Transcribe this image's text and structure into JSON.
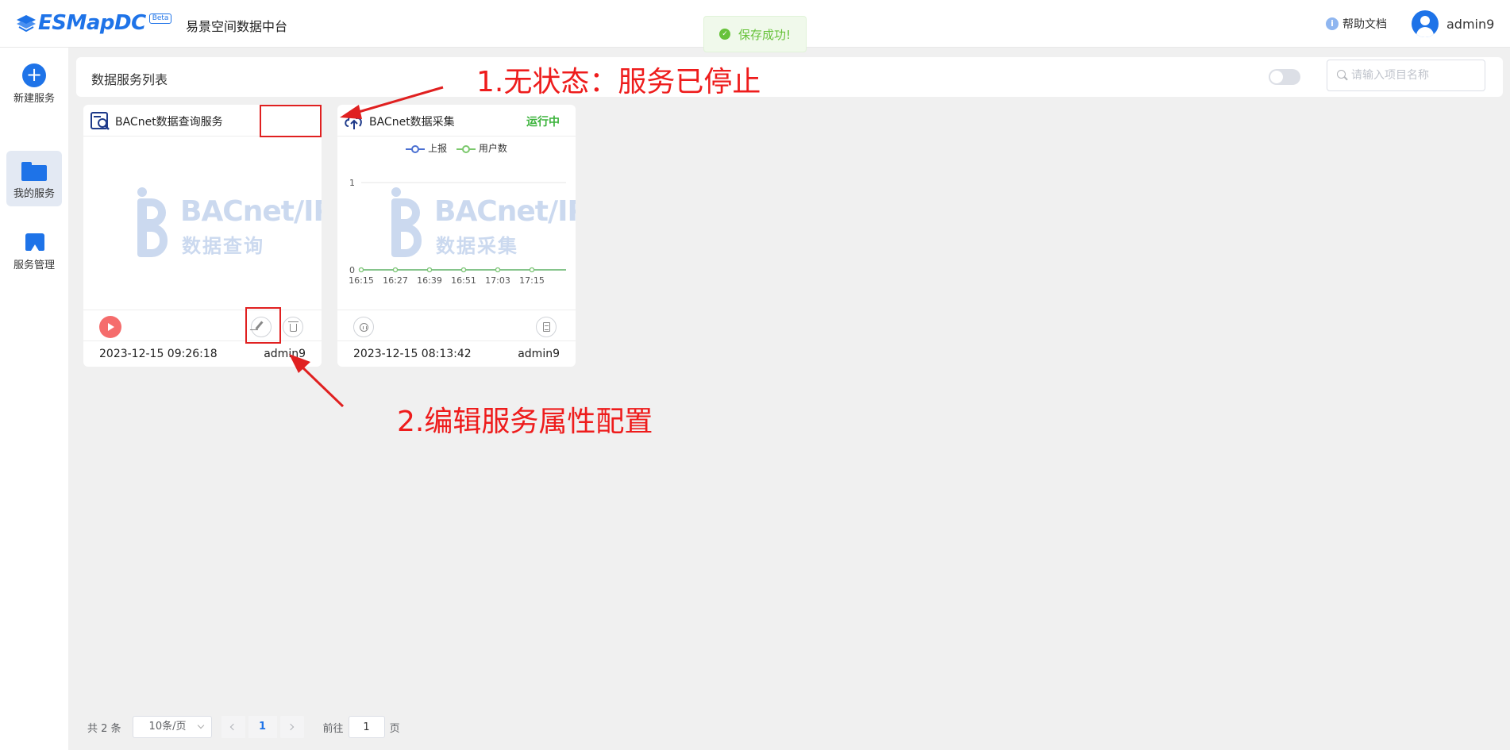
{
  "header": {
    "logo_text": "ESMapDC",
    "logo_badge": "Beta",
    "app_title": "易景空间数据中台",
    "help_label": "帮助文档",
    "username": "admin9"
  },
  "toast": {
    "message": "保存成功!"
  },
  "sidebar": {
    "items": [
      {
        "label": "新建服务",
        "icon": "plus-circle-icon"
      },
      {
        "label": "我的服务",
        "icon": "folder-icon",
        "active": true
      },
      {
        "label": "服务管理",
        "icon": "bookmark-icon"
      }
    ]
  },
  "list": {
    "title": "数据服务列表",
    "search_placeholder": "请输入项目名称",
    "toggle_on": false
  },
  "cards": [
    {
      "title": "BACnet数据查询服务",
      "status": "",
      "watermark_line1": "BACnet/IP",
      "watermark_line2": "数据查询",
      "date": "2023-12-15 09:26:18",
      "owner": "admin9"
    },
    {
      "title": "BACnet数据采集",
      "status": "运行中",
      "watermark_line1": "BACnet/IP",
      "watermark_line2": "数据采集",
      "date": "2023-12-15 08:13:42",
      "owner": "admin9"
    }
  ],
  "chart_data": {
    "type": "line",
    "title": "",
    "x": [
      "16:15",
      "16:27",
      "16:39",
      "16:51",
      "17:03",
      "17:15"
    ],
    "series": [
      {
        "name": "上报",
        "values": [
          0,
          0,
          0,
          0,
          0,
          0
        ],
        "color": "#4a6fd1"
      },
      {
        "name": "用户数",
        "values": [
          0,
          0,
          0,
          0,
          0,
          0
        ],
        "color": "#7bc86c"
      }
    ],
    "ylim": [
      0,
      1
    ],
    "yticks": [
      "0",
      "1"
    ],
    "legend": "top-center",
    "grid": true
  },
  "annotations": {
    "note1": "1.无状态：服务已停止",
    "note2": "2.编辑服务属性配置",
    "color": "#e02020"
  },
  "pagination": {
    "total": "共 2 条",
    "page_size": "10条/页",
    "current_page": "1",
    "goto_label": "前往",
    "goto_value": "1",
    "page_suffix": "页"
  }
}
